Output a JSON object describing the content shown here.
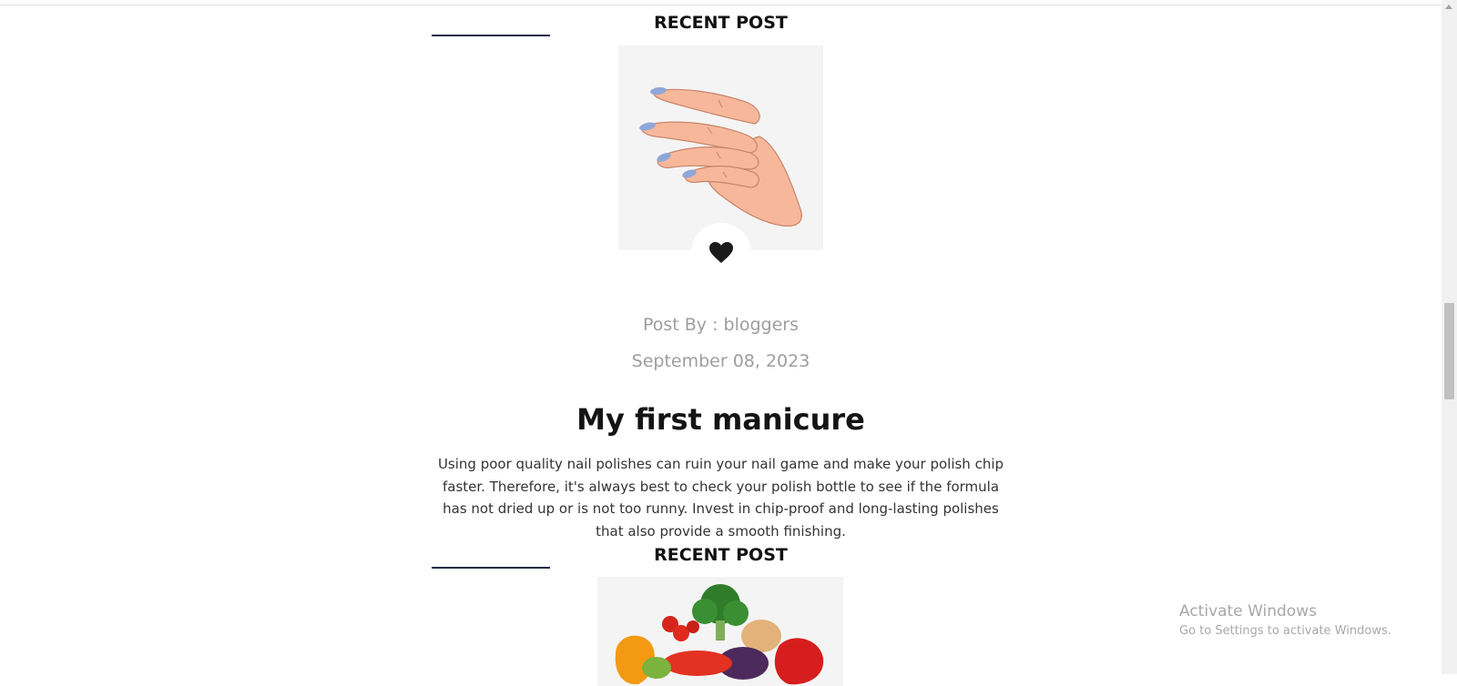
{
  "posts": [
    {
      "section_heading": "RECENT POST",
      "image_alt": "hand-with-blue-nails",
      "author_line": "Post By : bloggers",
      "date": "September 08, 2023",
      "title": "My first manicure",
      "excerpt": "Using poor quality nail polishes can ruin your nail game and make your polish chip faster. Therefore, it's always best to check your polish bottle to see if the formula has not dried up or is not too runny. Invest in chip-proof and long-lasting polishes that also provide a smooth finishing."
    },
    {
      "section_heading": "RECENT POST",
      "image_alt": "vegetables"
    }
  ],
  "like_button": {
    "icon": "heart-icon"
  },
  "watermark": {
    "title": "Activate Windows",
    "subtitle": "Go to Settings to activate Windows."
  },
  "colors": {
    "accent_line": "#1a2a44",
    "meta_text": "#9e9e9e",
    "nail_polish": "#8fa7d8",
    "skin": "#f7b79a"
  }
}
